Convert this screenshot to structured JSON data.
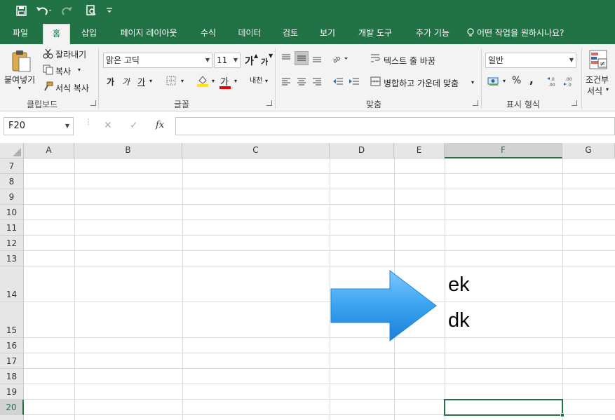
{
  "qat": {
    "save_icon": "save-icon",
    "undo_icon": "undo-icon",
    "redo_icon": "redo-icon",
    "print_preview_icon": "print-preview-icon",
    "customize_icon": "customize-qat-icon"
  },
  "tabs": [
    {
      "label": "파일"
    },
    {
      "label": "홈"
    },
    {
      "label": "삽입"
    },
    {
      "label": "페이지 레이아웃"
    },
    {
      "label": "수식"
    },
    {
      "label": "데이터"
    },
    {
      "label": "검토"
    },
    {
      "label": "보기"
    },
    {
      "label": "개발 도구"
    },
    {
      "label": "추가 기능"
    },
    {
      "label": "어떤 작업을 원하시나요?"
    }
  ],
  "clipboard": {
    "paste": "붙여넣기",
    "cut": "잘라내기",
    "copy": "복사",
    "format_painter": "서식 복사",
    "group_label": "클립보드"
  },
  "font": {
    "font_name": "맑은 고딕",
    "font_size": "11",
    "bold": "가",
    "italic": "가",
    "underline": "가",
    "increase": "가",
    "decrease": "가",
    "font_color_glyph": "가",
    "phonetic": "내천",
    "group_label": "글꼴"
  },
  "alignment": {
    "wrap_text": "텍스트 줄 바꿈",
    "merge_center": "병합하고 가운데 맞춤",
    "group_label": "맞춤"
  },
  "number": {
    "format": "일반",
    "percent": "%",
    "comma": ",",
    "group_label": "표시 형식"
  },
  "styles": {
    "conditional_line1": "조건부",
    "conditional_line2": "서식"
  },
  "formula_bar": {
    "name_box": "F20",
    "fx": "fx",
    "cancel": "✕",
    "enter": "✓"
  },
  "columns": [
    "A",
    "B",
    "C",
    "D",
    "E",
    "F",
    "G"
  ],
  "rows": [
    "7",
    "8",
    "9",
    "10",
    "11",
    "12",
    "13",
    "14",
    "15",
    "16",
    "17",
    "18",
    "19",
    "20"
  ],
  "cells": {
    "F14": "ek",
    "F15": "dk"
  },
  "colors": {
    "accent": "#217346",
    "arrow": "#3aa3f0"
  }
}
